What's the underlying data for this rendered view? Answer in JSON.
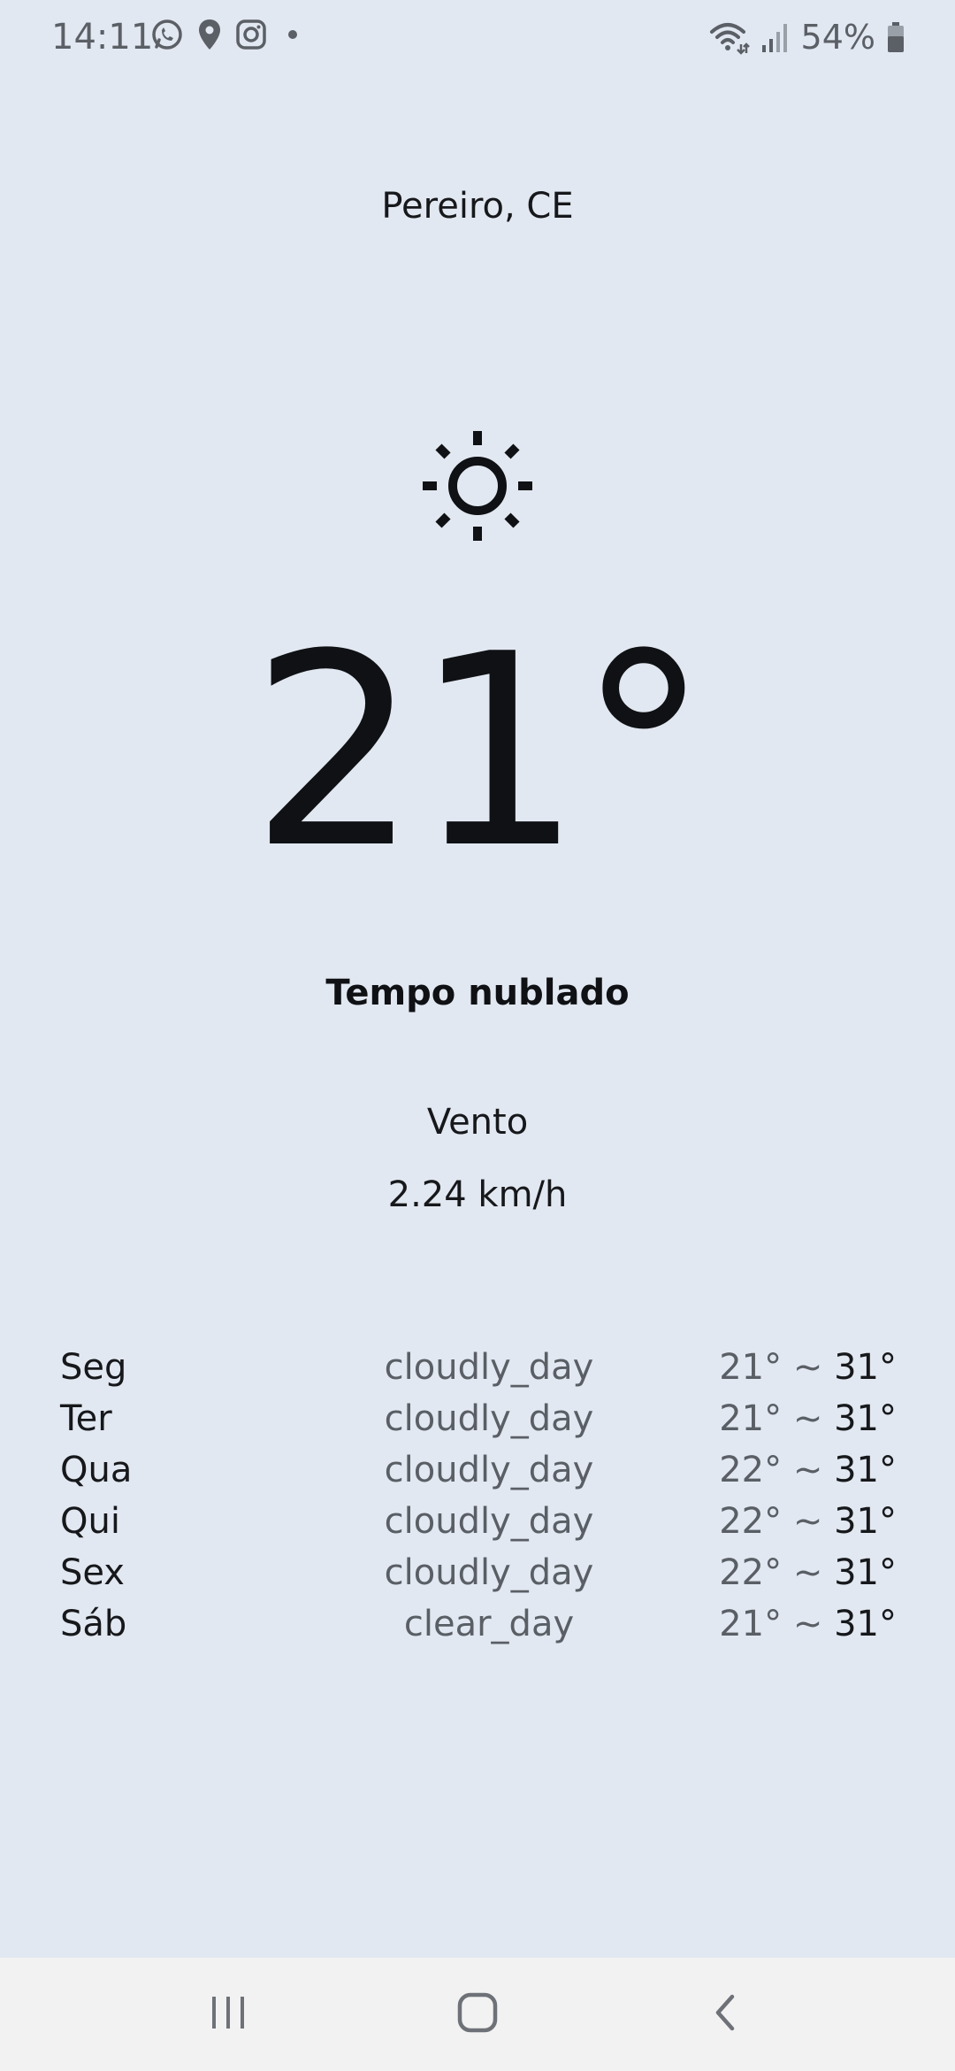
{
  "status_bar": {
    "time": "14:11",
    "battery": "54%",
    "icons_left": [
      "whatsapp-icon",
      "location-pin-icon",
      "instagram-icon",
      "dot-icon"
    ],
    "icons_right": [
      "wifi-icon",
      "signal-icon",
      "battery-icon"
    ]
  },
  "weather": {
    "city": "Pereiro, CE",
    "icon": "sun-icon",
    "temperature": "21°",
    "description": "Tempo nublado",
    "wind_label": "Vento",
    "wind_speed": "2.24 km/h"
  },
  "forecast": [
    {
      "day": "Seg",
      "condition": "cloudly_day",
      "min": "21°",
      "max": "31°"
    },
    {
      "day": "Ter",
      "condition": "cloudly_day",
      "min": "21°",
      "max": "31°"
    },
    {
      "day": "Qua",
      "condition": "cloudly_day",
      "min": "22°",
      "max": "31°"
    },
    {
      "day": "Qui",
      "condition": "cloudly_day",
      "min": "22°",
      "max": "31°"
    },
    {
      "day": "Sex",
      "condition": "cloudly_day",
      "min": "22°",
      "max": "31°"
    },
    {
      "day": "Sáb",
      "condition": "clear_day",
      "min": "21°",
      "max": "31°"
    }
  ],
  "forecast_separator": "~",
  "nav_bar": {
    "buttons": [
      "recent-apps-icon",
      "home-icon",
      "back-icon"
    ]
  },
  "colors": {
    "background": "#E2E8F1",
    "text_primary": "#0F1114",
    "text_secondary": "#5A5F66",
    "nav_background": "#F2F2F2"
  }
}
